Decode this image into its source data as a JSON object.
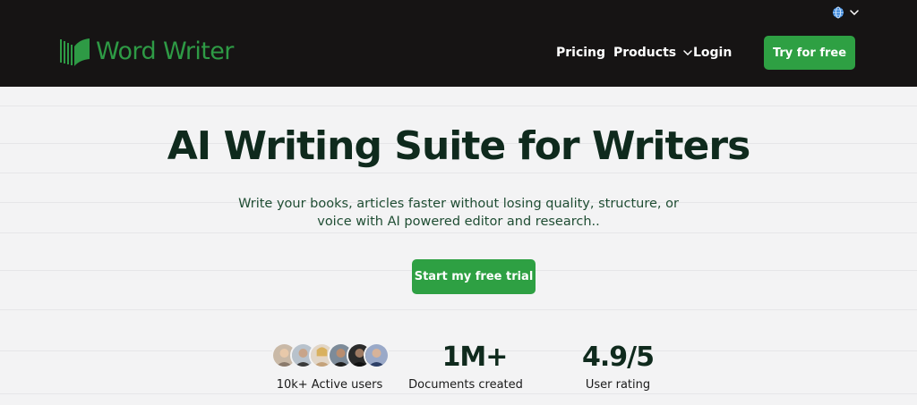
{
  "header": {
    "brand": "Word Writer",
    "nav": {
      "pricing": "Pricing",
      "products": "Products",
      "login": "Login"
    },
    "cta": "Try for free",
    "language_icon": "globe-icon"
  },
  "hero": {
    "title": "AI Writing Suite for Writers",
    "subtitle": "Write your books, articles faster without losing quality, structure, or voice with AI powered editor and research..",
    "cta": "Start my free trial"
  },
  "stats": {
    "users": {
      "label": "10k+ Active users"
    },
    "documents": {
      "value": "1M+",
      "label": "Documents created"
    },
    "rating": {
      "value": "4.9/5",
      "label": "User rating"
    }
  },
  "colors": {
    "header_bg": "#161414",
    "brand_green": "#2ea043",
    "title": "#0f2a1d",
    "page_bg": "#f3f3f4"
  }
}
